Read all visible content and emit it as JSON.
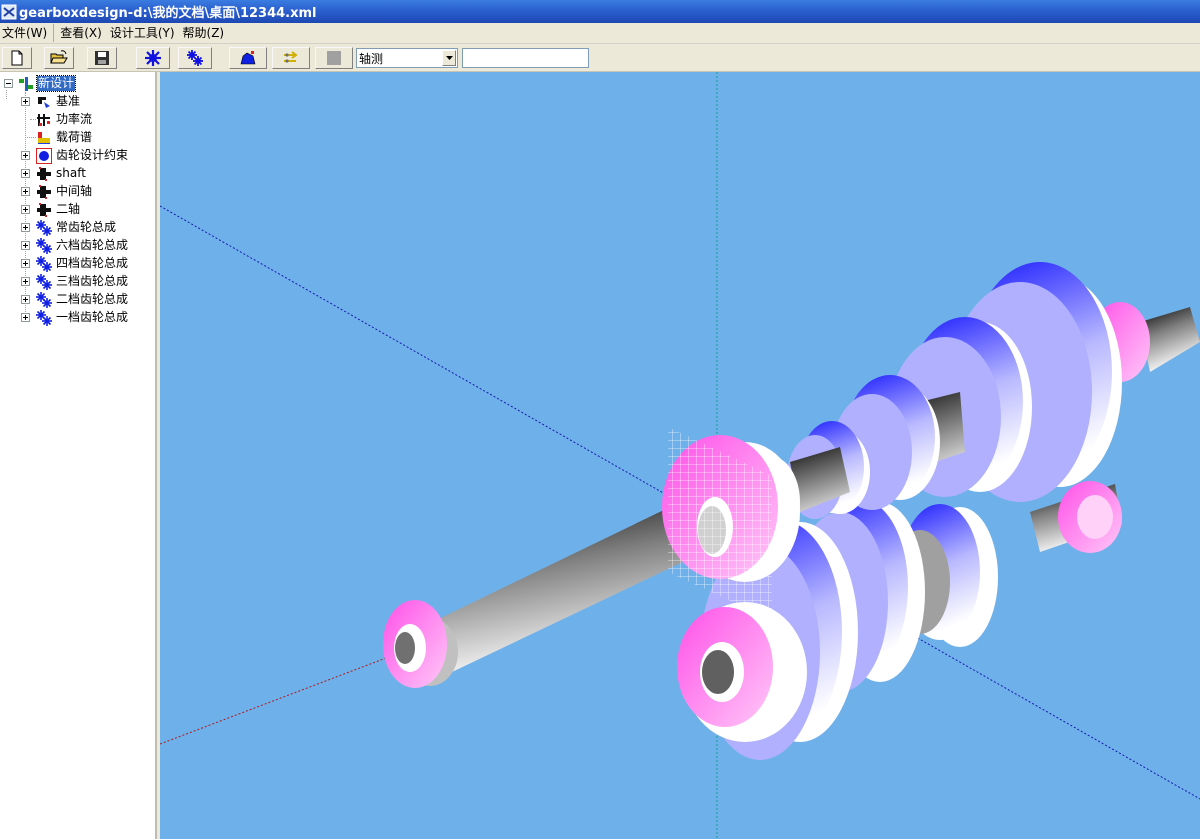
{
  "window": {
    "title": "gearboxdesign-d:\\我的文档\\桌面\\12344.xml",
    "app_icon": "gearbox-app-icon"
  },
  "menu": [
    {
      "label": "文件(W)"
    },
    {
      "label": "查看(X)"
    },
    {
      "label": "设计工具(Y)"
    },
    {
      "label": "帮助(Z)"
    }
  ],
  "toolbar": {
    "buttons": [
      {
        "icon": "new-file-icon"
      },
      {
        "icon": "open-folder-icon"
      },
      {
        "icon": "save-disk-icon"
      },
      {
        "icon": "gear-star-icon"
      },
      {
        "icon": "gear-pair-icon"
      },
      {
        "icon": "assembly-icon"
      },
      {
        "icon": "power-flow-icon"
      },
      {
        "icon": "gray-square-icon"
      }
    ],
    "view_select": {
      "value": "轴测"
    },
    "input_value": ""
  },
  "tree": {
    "root": {
      "label": "新设计",
      "icon": "design-root-icon",
      "selected": true
    },
    "children": [
      {
        "label": "基准",
        "icon": "datum-icon",
        "expandable": true
      },
      {
        "label": "功率流",
        "icon": "power-flow-icon",
        "expandable": false
      },
      {
        "label": "载荷谱",
        "icon": "load-spectrum-icon",
        "expandable": false
      },
      {
        "label": "齿轮设计约束",
        "icon": "constraint-icon",
        "expandable": true
      },
      {
        "label": "shaft",
        "icon": "shaft-icon",
        "expandable": true
      },
      {
        "label": "中间轴",
        "icon": "shaft-icon",
        "expandable": true
      },
      {
        "label": "二轴",
        "icon": "shaft-icon",
        "expandable": true
      },
      {
        "label": "常齿轮总成",
        "icon": "gear-icon",
        "expandable": true
      },
      {
        "label": "六档齿轮总成",
        "icon": "gear-icon",
        "expandable": true
      },
      {
        "label": "四档齿轮总成",
        "icon": "gear-icon",
        "expandable": true
      },
      {
        "label": "三档齿轮总成",
        "icon": "gear-icon",
        "expandable": true
      },
      {
        "label": "二档齿轮总成",
        "icon": "gear-icon",
        "expandable": true
      },
      {
        "label": "一档齿轮总成",
        "icon": "gear-icon",
        "expandable": true
      }
    ]
  },
  "viewport": {
    "background": "#6eb0ea",
    "axis_colors": {
      "x": "#b01818",
      "y": "#10a090",
      "z": "#1818b0"
    },
    "gear_colors": {
      "pink": "#ff66ee",
      "blue": "#2020ff",
      "lavender": "#b0b0ff",
      "white": "#ffffff"
    }
  }
}
